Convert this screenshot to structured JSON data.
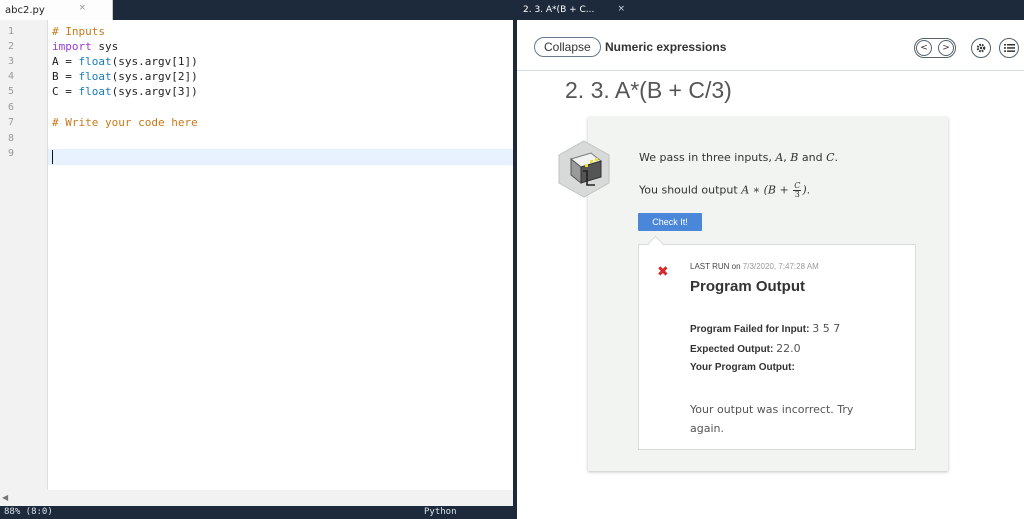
{
  "editor": {
    "tab": {
      "title": "abc2.py",
      "close": "×"
    },
    "line_numbers": [
      "1",
      "2",
      "3",
      "4",
      "5",
      "6",
      "7",
      "8",
      "9"
    ],
    "lines": [
      {
        "comment": "# Inputs"
      },
      {
        "keyword": "import",
        "text": " sys"
      },
      {
        "var": "A = ",
        "fn": "float",
        "rest": "(sys.argv[1])"
      },
      {
        "var": "B = ",
        "fn": "float",
        "rest": "(sys.argv[2])"
      },
      {
        "var": "C = ",
        "fn": "float",
        "rest": "(sys.argv[3])"
      },
      {
        "text": ""
      },
      {
        "comment": "# Write your code here"
      },
      {
        "text": ""
      },
      {
        "text": ""
      }
    ],
    "status": {
      "position": "88% (8:0)",
      "language": "Python"
    }
  },
  "lesson": {
    "tab": {
      "title": "2. 3. A*(B + C...",
      "close": "×"
    },
    "collapse_label": "Collapse",
    "section_title": "Numeric expressions",
    "nav_prev": "<",
    "nav_next": ">",
    "icons": {
      "settings": "gear-icon",
      "menu": "list-icon",
      "failure": "x-mark-icon"
    },
    "page_title": "2. 3. A*(B + C/3)",
    "prompt": {
      "pre": "We pass in three inputs, ",
      "a": "A",
      "sep1": ", ",
      "b": "B",
      "sep2": " and ",
      "c": "C",
      "post": "."
    },
    "instruction": {
      "pre": "You should output ",
      "expr_a": "A ∗ (B + ",
      "frac_num": "C",
      "frac_den": "3",
      "expr_close": ")",
      "post": "."
    },
    "check_button": "Check It!",
    "output": {
      "last_run_label": "LAST RUN on ",
      "last_run_time": "7/3/2020, 7:47:28 AM",
      "title": "Program Output",
      "failed_label": "Program Failed for Input: ",
      "failed_value": "3 5 7",
      "expected_label": "Expected Output: ",
      "expected_value": "22.0",
      "your_label": "Your Program Output:",
      "message": "Your output was incorrect. Try again."
    }
  },
  "colors": {
    "chrome": "#1c2a3b",
    "accent": "#4a87d8",
    "failure": "#d92a2a",
    "comment": "#c87a1a",
    "keyword": "#9a3bd0",
    "function": "#1a7bb5"
  }
}
